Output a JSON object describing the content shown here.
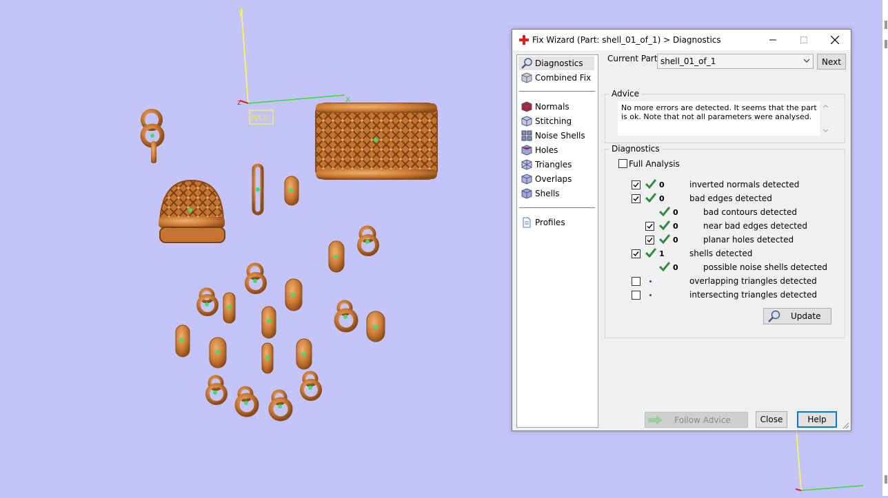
{
  "viewport": {
    "axis_top": {
      "y": "y",
      "x": "x",
      "z": "z"
    },
    "wcs_label": "WCS"
  },
  "dialog": {
    "title": "Fix Wizard (Part: shell_01_of_1) > Diagnostics",
    "nav": {
      "top_items": [
        {
          "label": "Diagnostics",
          "icon": "magnifier-icon",
          "selected": true
        },
        {
          "label": "Combined Fix",
          "icon": "cube-icon"
        }
      ],
      "fix_items": [
        {
          "label": "Normals",
          "icon": "normals-cube-icon"
        },
        {
          "label": "Stitching",
          "icon": "stitching-cube-icon"
        },
        {
          "label": "Noise Shells",
          "icon": "noise-shells-icon"
        },
        {
          "label": "Holes",
          "icon": "holes-cube-icon"
        },
        {
          "label": "Triangles",
          "icon": "triangles-icon"
        },
        {
          "label": "Overlaps",
          "icon": "overlaps-cube-icon"
        },
        {
          "label": "Shells",
          "icon": "shells-cube-icon"
        }
      ],
      "bottom_items": [
        {
          "label": "Profiles",
          "icon": "document-icon"
        }
      ]
    },
    "current_part_label": "Current Part:",
    "current_part_value": "shell_01_of_1",
    "next_button": "Next",
    "advice": {
      "title": "Advice",
      "text": "No more errors are detected. It seems that the part is ok. Note that not all parameters were analysed."
    },
    "diagnostics": {
      "title": "Diagnostics",
      "full_analysis_label": "Full Analysis",
      "full_analysis_checked": false,
      "rows": [
        {
          "label": "inverted normals detected",
          "value": "0",
          "checkbox": true,
          "checked": true,
          "status": "ok",
          "indent": 0
        },
        {
          "label": "bad edges detected",
          "value": "0",
          "checkbox": true,
          "checked": true,
          "status": "ok",
          "indent": 0
        },
        {
          "label": "bad contours detected",
          "value": "0",
          "checkbox": false,
          "checked": false,
          "status": "ok",
          "indent": 1
        },
        {
          "label": "near bad edges detected",
          "value": "0",
          "checkbox": true,
          "checked": true,
          "status": "ok",
          "indent": 1
        },
        {
          "label": "planar holes detected",
          "value": "0",
          "checkbox": true,
          "checked": true,
          "status": "ok",
          "indent": 1
        },
        {
          "label": "shells detected",
          "value": "1",
          "checkbox": true,
          "checked": true,
          "status": "ok",
          "indent": 0
        },
        {
          "label": "possible noise shells detected",
          "value": "0",
          "checkbox": false,
          "checked": false,
          "status": "ok",
          "indent": 1
        },
        {
          "label": "overlapping triangles detected",
          "value": "",
          "checkbox": true,
          "checked": false,
          "status": "pending",
          "indent": 0
        },
        {
          "label": "intersecting triangles detected",
          "value": "",
          "checkbox": true,
          "checked": false,
          "status": "pending",
          "indent": 0
        }
      ],
      "update_button": "Update"
    },
    "footer": {
      "follow_advice": "Follow Advice",
      "close": "Close",
      "help": "Help"
    }
  },
  "colors": {
    "viewport_bg": "#c4c4f8",
    "part_color": "#c97a34",
    "check_green": "#2e8b3d",
    "focus_blue": "#0078d7"
  }
}
